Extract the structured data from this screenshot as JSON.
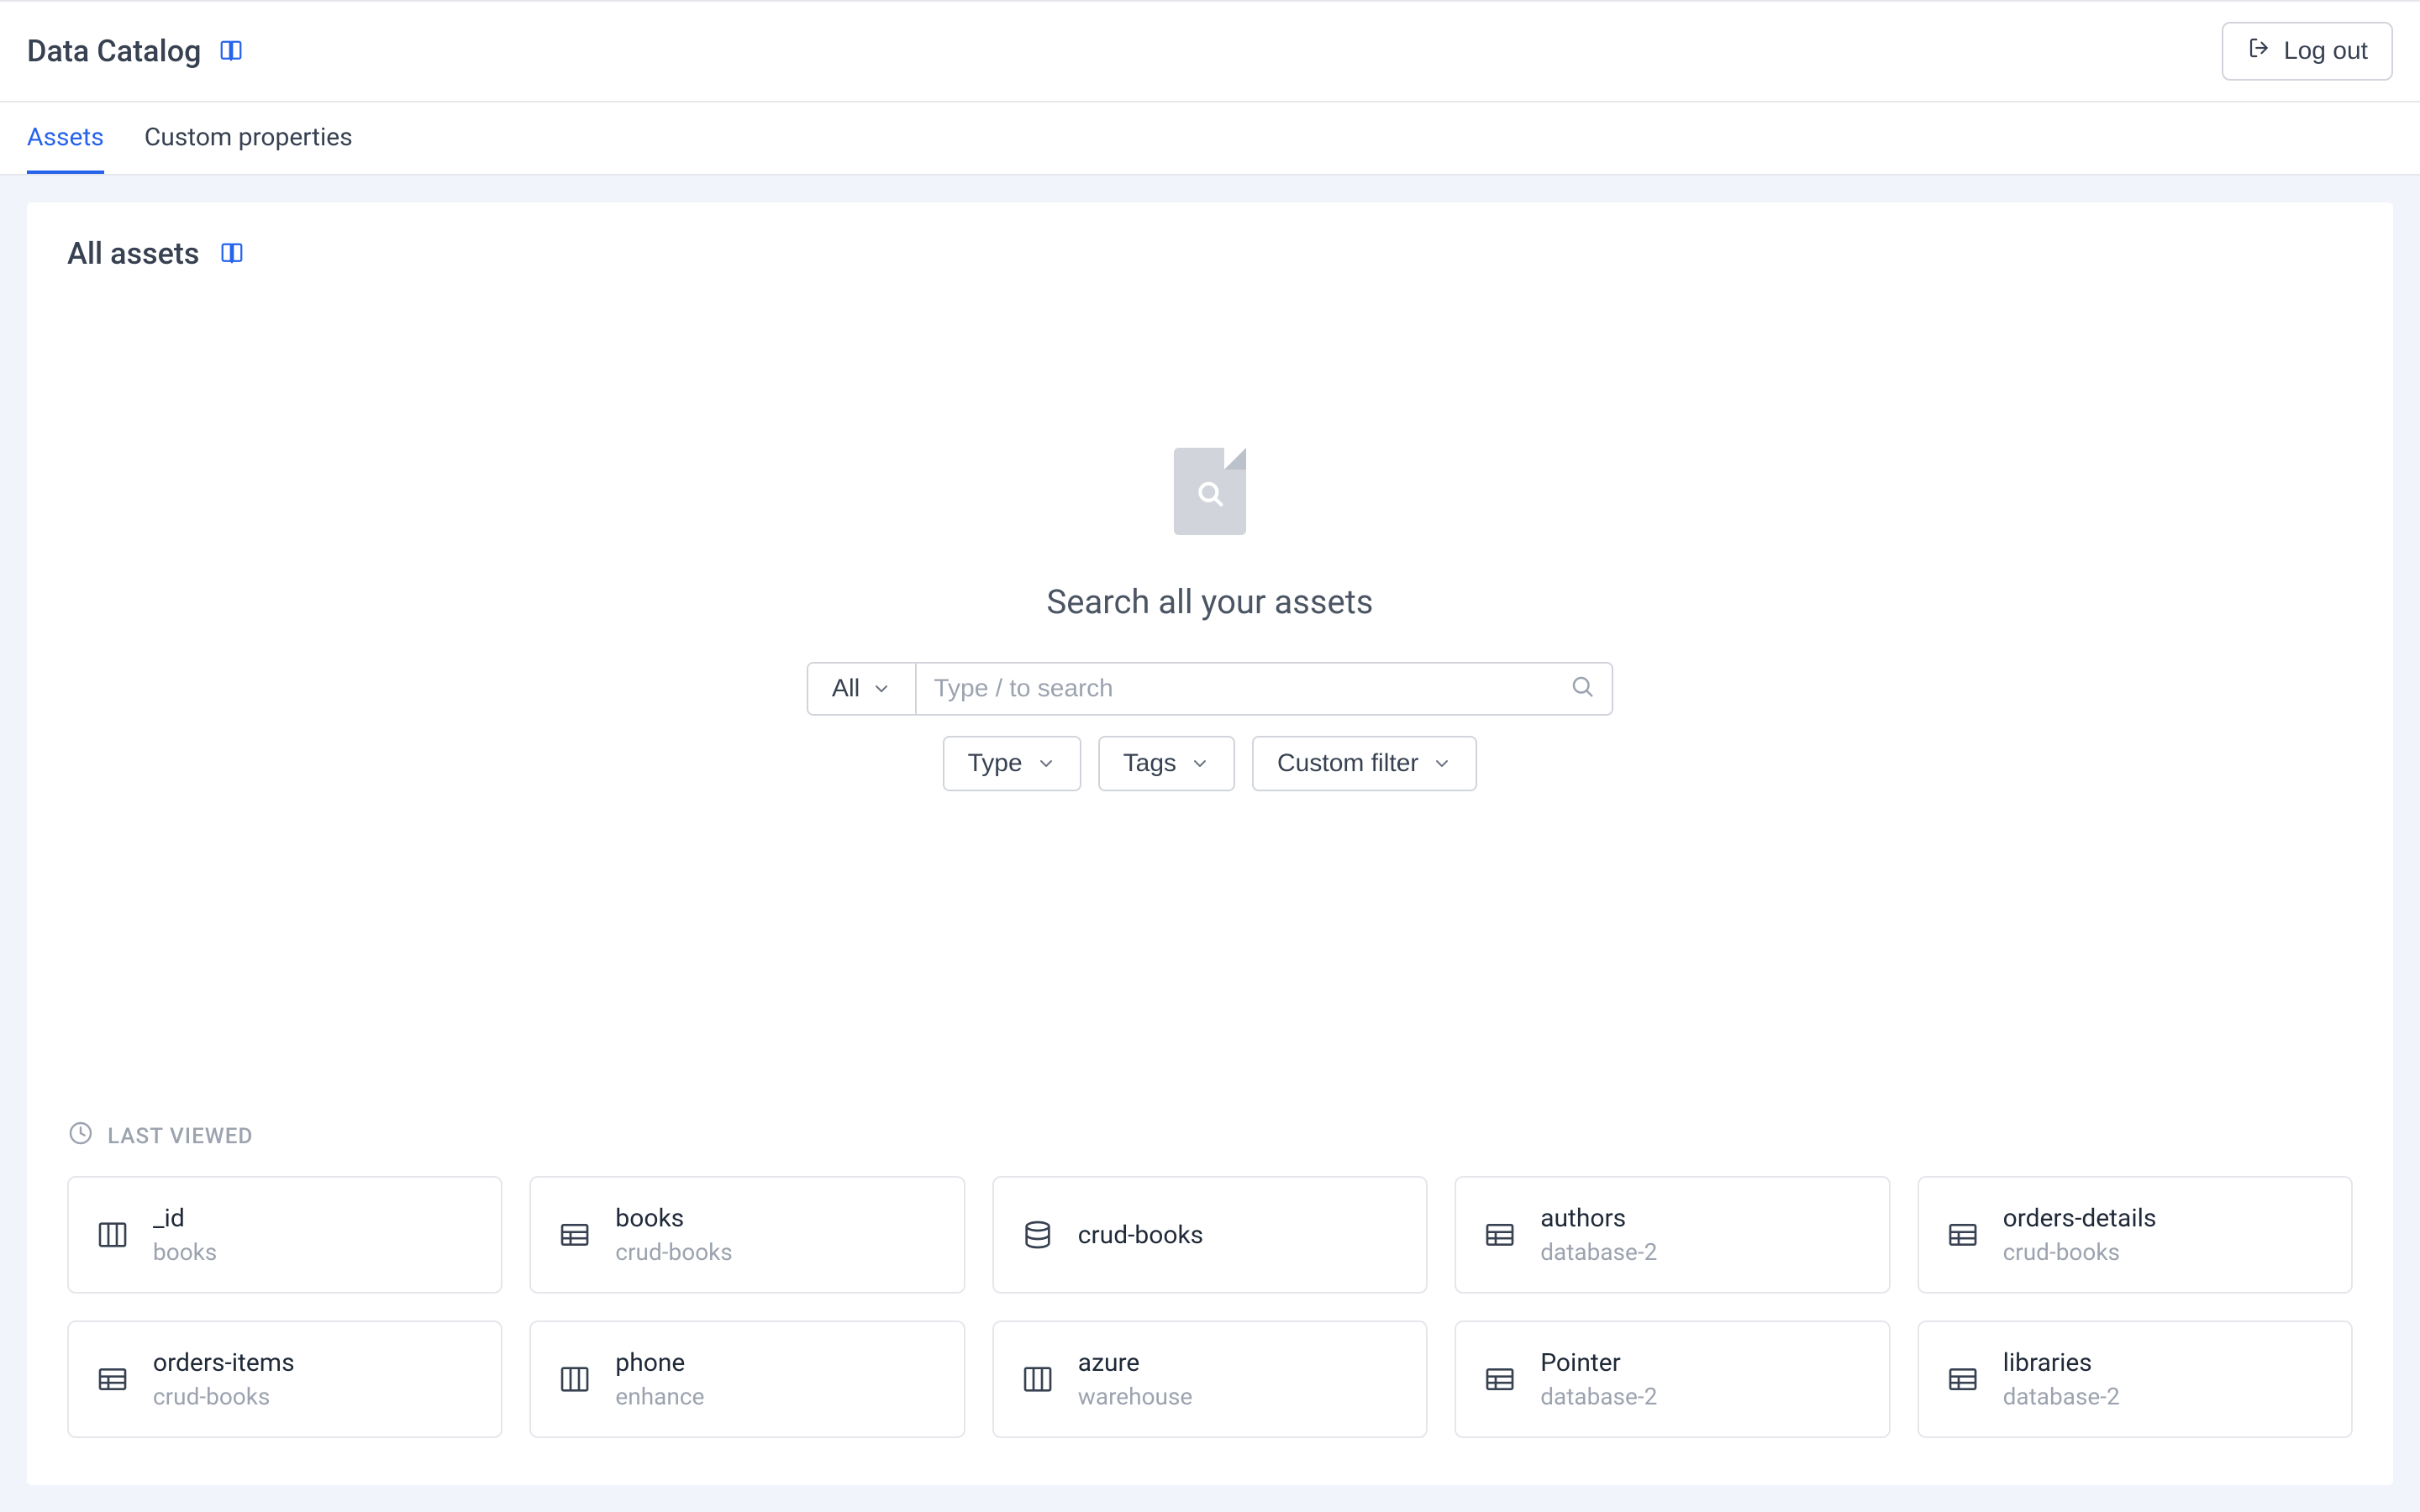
{
  "header": {
    "title": "Data Catalog",
    "logout_label": "Log out"
  },
  "tabs": [
    {
      "label": "Assets",
      "active": true
    },
    {
      "label": "Custom properties",
      "active": false
    }
  ],
  "main": {
    "panel_title": "All assets",
    "search_heading": "Search all your assets",
    "search": {
      "scope_label": "All",
      "placeholder": "Type / to search"
    },
    "filters": {
      "type_label": "Type",
      "tags_label": "Tags",
      "custom_label": "Custom filter"
    },
    "last_viewed": {
      "section_label": "LAST VIEWED",
      "items": [
        {
          "name": "_id",
          "sub": "books",
          "icon": "column"
        },
        {
          "name": "books",
          "sub": "crud-books",
          "icon": "table"
        },
        {
          "name": "crud-books",
          "sub": "",
          "icon": "database"
        },
        {
          "name": "authors",
          "sub": "database-2",
          "icon": "table"
        },
        {
          "name": "orders-details",
          "sub": "crud-books",
          "icon": "table"
        },
        {
          "name": "orders-items",
          "sub": "crud-books",
          "icon": "table"
        },
        {
          "name": "phone",
          "sub": "enhance",
          "icon": "column"
        },
        {
          "name": "azure",
          "sub": "warehouse",
          "icon": "column"
        },
        {
          "name": "Pointer",
          "sub": "database-2",
          "icon": "table"
        },
        {
          "name": "libraries",
          "sub": "database-2",
          "icon": "table"
        }
      ]
    }
  },
  "colors": {
    "accent": "#2563eb",
    "border": "#d1d5db",
    "muted": "#9ca3af"
  }
}
